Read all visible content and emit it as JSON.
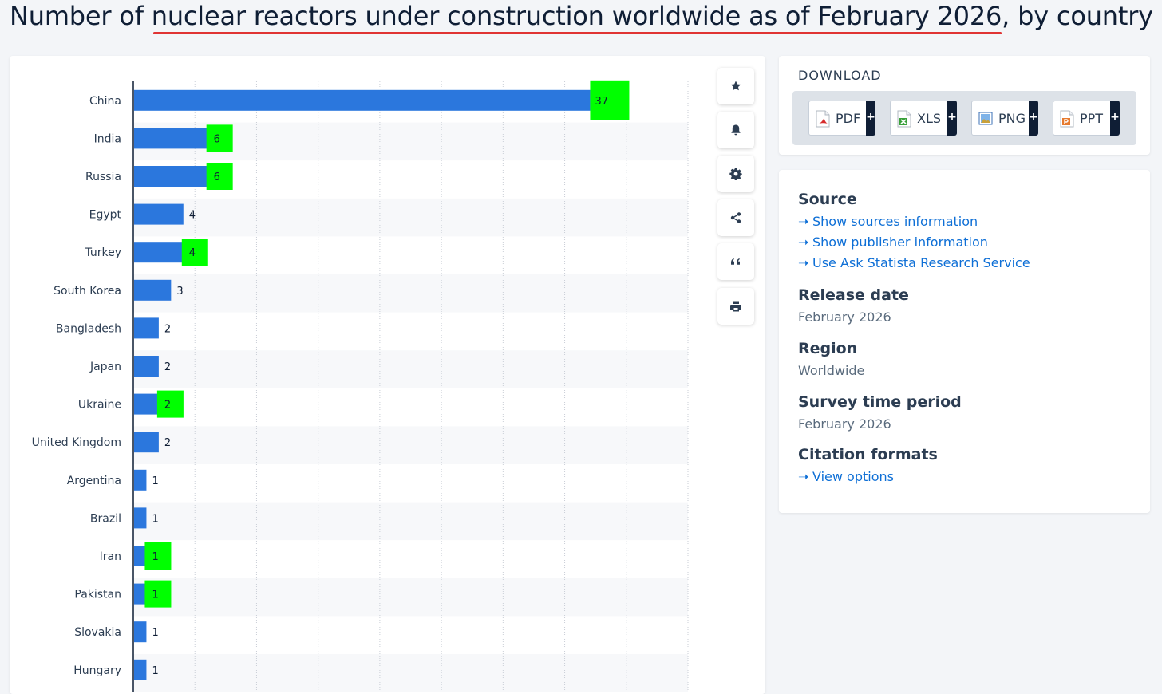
{
  "page": {
    "title": "Number of nuclear reactors under construction worldwide as of February 2026, by country"
  },
  "colors": {
    "bar": "#2b77dd",
    "highlight": "#00ff00",
    "title_underline": "#e03434",
    "link": "#0e6fd6"
  },
  "chart_data": {
    "type": "bar",
    "orientation": "horizontal",
    "categories": [
      "China",
      "India",
      "Russia",
      "Egypt",
      "Turkey",
      "South Korea",
      "Bangladesh",
      "Japan",
      "Ukraine",
      "United Kingdom",
      "Argentina",
      "Brazil",
      "Iran",
      "Pakistan",
      "Slovakia",
      "Hungary"
    ],
    "values": [
      37,
      6,
      6,
      4,
      4,
      3,
      2,
      2,
      2,
      2,
      1,
      1,
      1,
      1,
      1,
      1
    ],
    "highlighted": [
      "China",
      "India",
      "Russia",
      "Turkey",
      "Ukraine",
      "Iran",
      "Pakistan"
    ],
    "xlim": [
      0,
      45
    ],
    "grid": true
  },
  "toolbar": {
    "icons": [
      "star-icon",
      "bell-icon",
      "gear-icon",
      "share-icon",
      "quote-icon",
      "print-icon"
    ]
  },
  "download": {
    "title": "DOWNLOAD",
    "buttons": [
      {
        "label": "PDF",
        "icon": "pdf-file-icon",
        "plus": "+"
      },
      {
        "label": "XLS",
        "icon": "xls-file-icon",
        "plus": "+"
      },
      {
        "label": "PNG",
        "icon": "png-file-icon",
        "plus": "+"
      },
      {
        "label": "PPT",
        "icon": "ppt-file-icon",
        "plus": "+"
      }
    ]
  },
  "info": {
    "source_heading": "Source",
    "links": [
      "Show sources information",
      "Show publisher information",
      "Use Ask Statista Research Service"
    ],
    "release_heading": "Release date",
    "release_value": "February 2026",
    "region_heading": "Region",
    "region_value": "Worldwide",
    "survey_heading": "Survey time period",
    "survey_value": "February 2026",
    "citation_heading": "Citation formats",
    "citation_link": "View options"
  }
}
